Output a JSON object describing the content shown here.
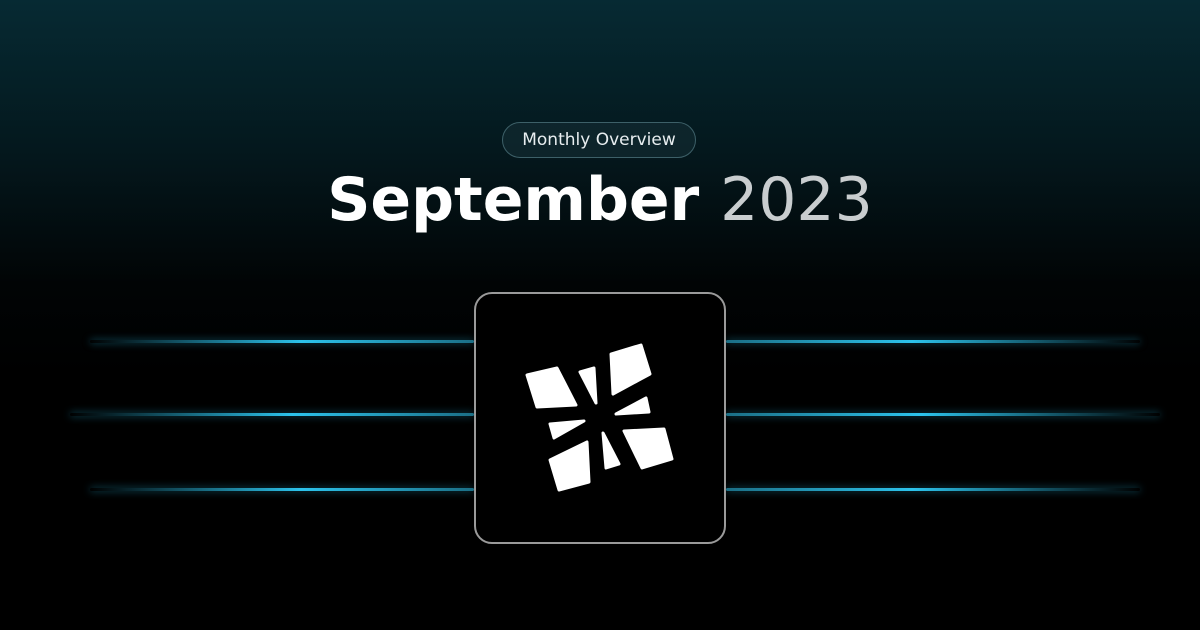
{
  "badge": {
    "label": "Monthly Overview"
  },
  "title": {
    "month": "September",
    "year": "2023"
  },
  "logo": {
    "icon": "abstract-shards-logo",
    "fill": "#ffffff",
    "box_border": "#9a9a9a"
  },
  "colors": {
    "accent_line": "#2cc3ec",
    "background_top": "#062a33",
    "background_bottom": "#000000"
  }
}
